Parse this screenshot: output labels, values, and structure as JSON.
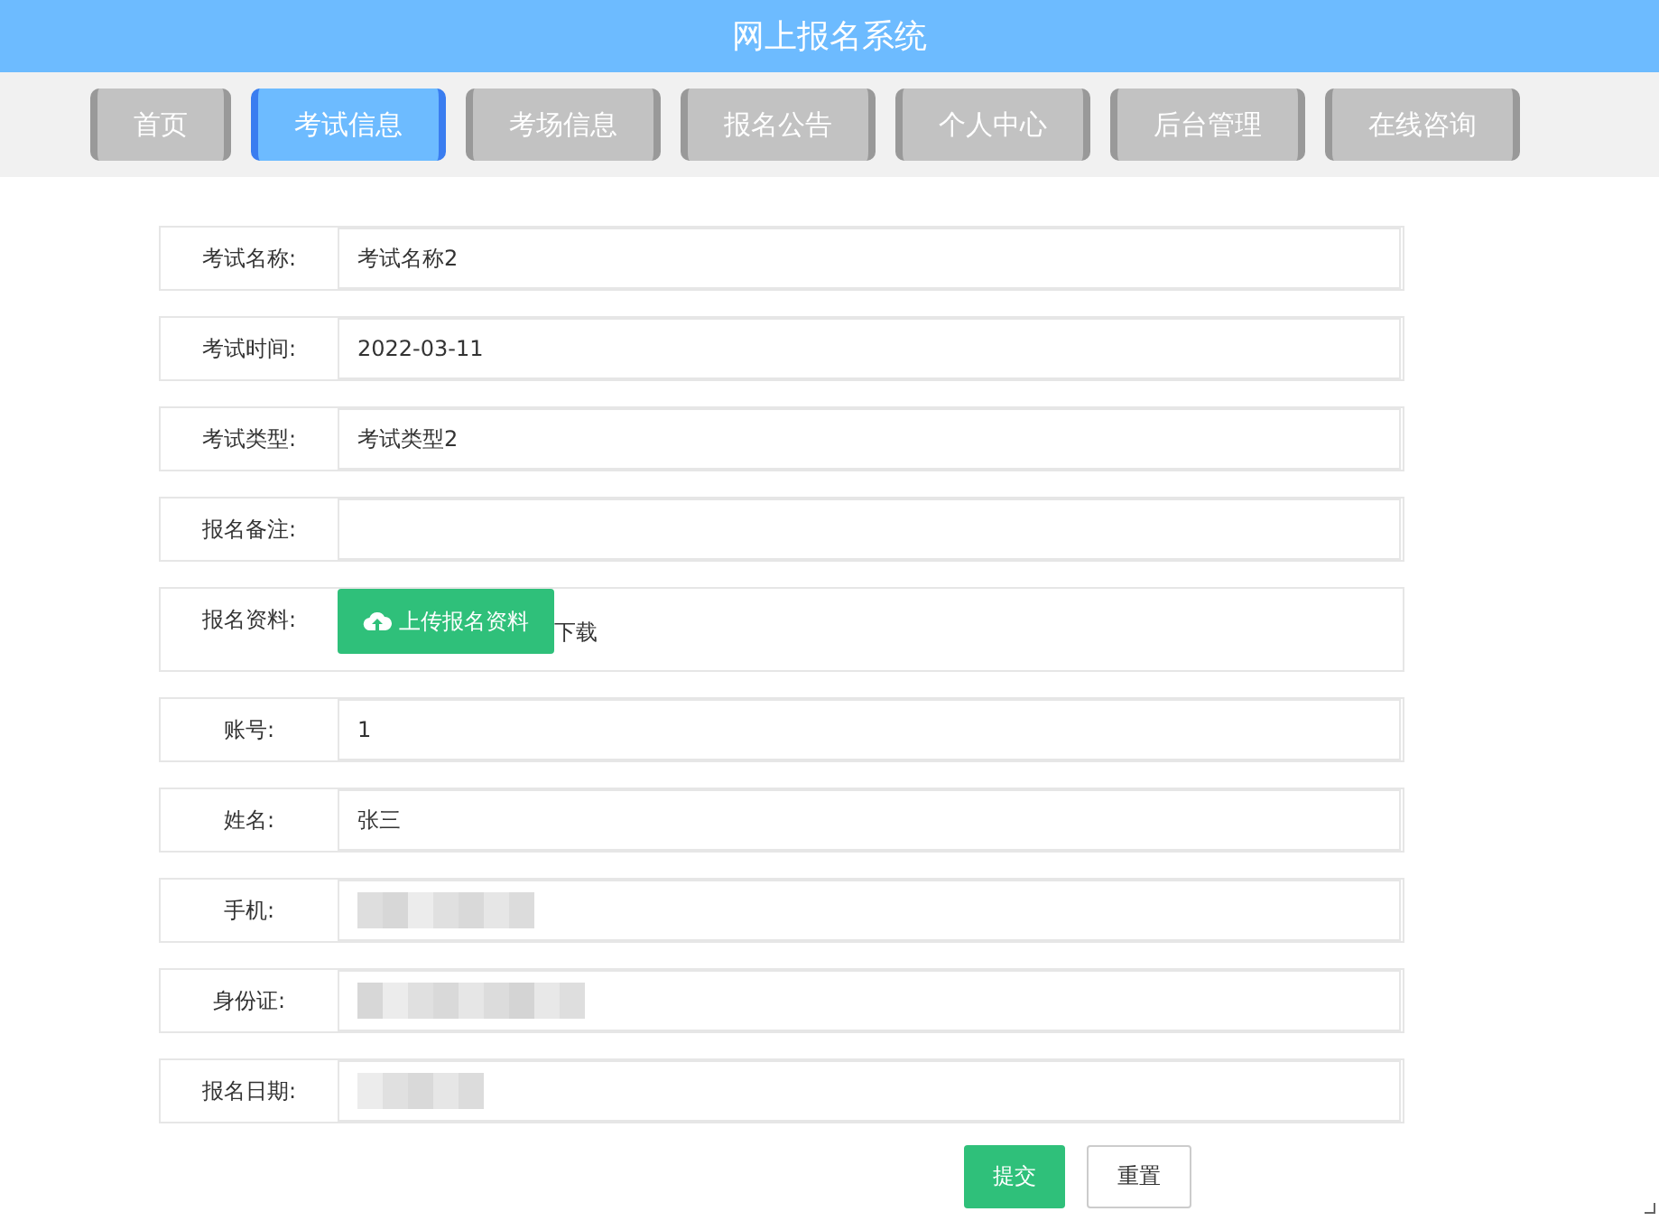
{
  "header": {
    "title": "网上报名系统"
  },
  "nav_tabs": [
    {
      "label": "首页",
      "selected": false
    },
    {
      "label": "考试信息",
      "selected": true
    },
    {
      "label": "考场信息",
      "selected": false
    },
    {
      "label": "报名公告",
      "selected": false
    },
    {
      "label": "个人中心",
      "selected": false
    },
    {
      "label": "后台管理",
      "selected": false
    },
    {
      "label": "在线咨询",
      "selected": false
    }
  ],
  "form_rows": [
    {
      "kind": "text",
      "label": "考试名称:",
      "value": "考试名称2",
      "redacted": false
    },
    {
      "kind": "text",
      "label": "考试时间:",
      "value": "2022-03-11",
      "redacted": false
    },
    {
      "kind": "text",
      "label": "考试类型:",
      "value": "考试类型2",
      "redacted": false
    },
    {
      "kind": "text",
      "label": "报名备注:",
      "redacted": false
    },
    {
      "kind": "upload",
      "label": "报名资料:",
      "button": "上传报名资料",
      "link": "下载"
    },
    {
      "kind": "text",
      "label": "账号:",
      "value": "1",
      "redacted": false
    },
    {
      "kind": "text",
      "label": "姓名:",
      "value": "张三",
      "redacted": false
    },
    {
      "kind": "text",
      "label": "手机:",
      "redacted": true
    },
    {
      "kind": "text",
      "label": "身份证:",
      "redacted": true
    },
    {
      "kind": "text",
      "label": "报名日期:",
      "redacted": true
    }
  ],
  "buttons": [
    {
      "label": "提交",
      "kind": "primary"
    },
    {
      "label": "重置",
      "kind": "default"
    }
  ]
}
